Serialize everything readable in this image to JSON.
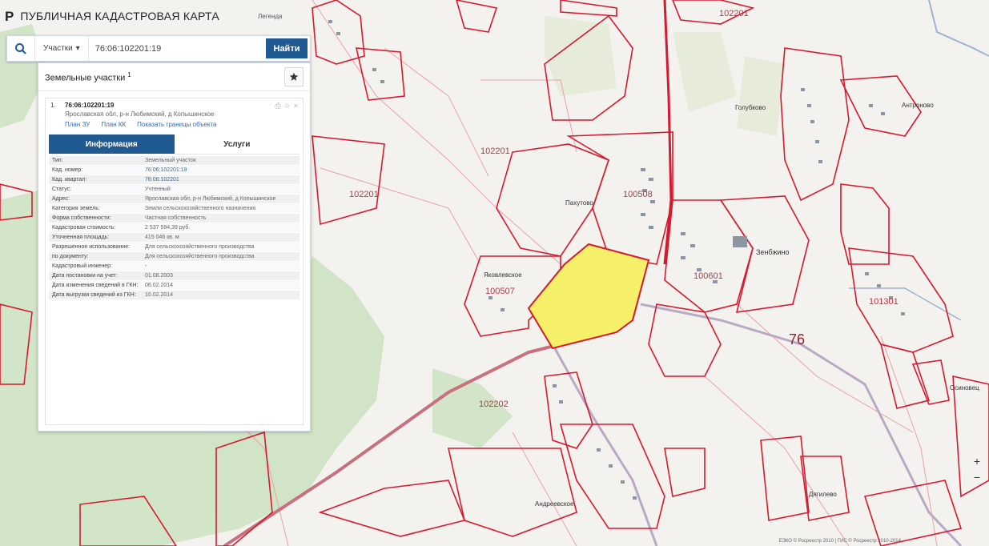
{
  "app": {
    "title": "ПУБЛИЧНАЯ КАДАСТРОВАЯ КАРТА",
    "logo_glyph": "Р",
    "legend": "Легенда"
  },
  "search": {
    "type_label": "Участки",
    "query": "76:06:102201:19",
    "button": "Найти",
    "icon": "search-icon"
  },
  "results": {
    "title": "Земельные участки",
    "count": "1",
    "item": {
      "number": "1.",
      "cadastral_number": "76:06:102201:19",
      "address": "Ярославская обл, р-н Любимский, д Копышинское",
      "links": [
        "План ЗУ",
        "План КК",
        "Показать границы объекта"
      ]
    },
    "tabs": [
      "Информация",
      "Услуги"
    ],
    "info_rows": [
      {
        "label": "Тип:",
        "value": "Земельный участок"
      },
      {
        "label": "Кад. номер:",
        "value": "76:06:102201:19"
      },
      {
        "label": "Кад. квартал:",
        "value": "76:06:102201"
      },
      {
        "label": "Статус:",
        "value": "Учтенный"
      },
      {
        "label": "Адрес:",
        "value": "Ярославская обл, р-н Любимский, д Копышинское"
      },
      {
        "label": "Категория земель:",
        "value": "Земли сельскохозяйственного назначения"
      },
      {
        "label": "Форма собственности:",
        "value": "Частная собственность"
      },
      {
        "label": "Кадастровая стоимость:",
        "value": "2 537 594,39 руб."
      },
      {
        "label": "Уточненная площадь:",
        "value": "415 046 кв. м"
      },
      {
        "label": "Разрешенное использование:",
        "value": "Для сельскохозяйственного производства"
      },
      {
        "label": "по документу:",
        "value": "Для сельскохозяйственного производства"
      },
      {
        "label": "Кадастровый инженер:",
        "value": "-"
      },
      {
        "label": "Дата постановки на учет:",
        "value": "01.08.2003"
      },
      {
        "label": "Дата изменения сведений в ГКН:",
        "value": "06.02.2014"
      },
      {
        "label": "Дата выгрузки сведений из ГКН:",
        "value": "10.02.2014"
      }
    ]
  },
  "map": {
    "labels": {
      "quarter_a": "102201",
      "quarter_b": "102201",
      "quarter_c": "100508",
      "quarter_d": "100507",
      "quarter_e": "100601",
      "quarter_f": "101301",
      "quarter_g": "102201",
      "quarter_h": "102202",
      "region": "76",
      "village_main": "Зенбжино",
      "village_a": "Пахутово",
      "village_b": "Голубково",
      "village_c": "Антроново",
      "village_d": "Андреевское",
      "village_e": "Яковлевское",
      "village_f": "Осиновец",
      "village_g": "Дягилево"
    },
    "highlight_color": "#f5ef6a",
    "parcel_color": "#d7192f"
  },
  "controls": {
    "zoom_in": "+",
    "zoom_out": "−"
  },
  "attribution": "ЕЭКО © Росреестр 2010 | ГИС © Росреестр 2010-2014"
}
